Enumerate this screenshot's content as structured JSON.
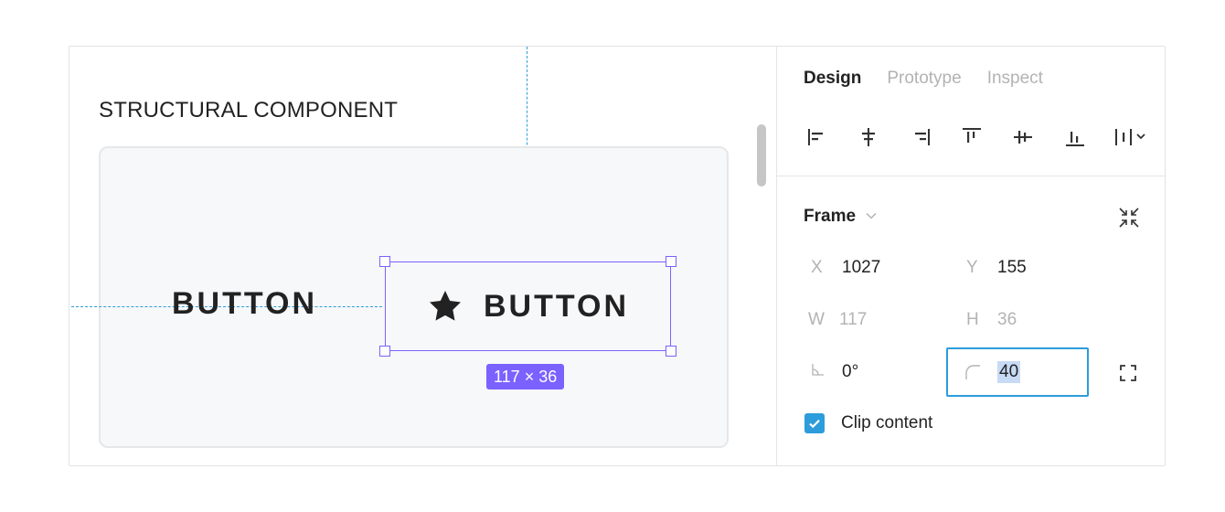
{
  "canvas": {
    "title": "STRUCTURAL COMPONENT",
    "text_button_label": "BUTTON",
    "icon_button_label": "BUTTON",
    "icon_button_icon": "star-icon",
    "size_badge": "117 × 36"
  },
  "panel": {
    "tabs": [
      {
        "label": "Design",
        "active": true
      },
      {
        "label": "Prototype",
        "active": false
      },
      {
        "label": "Inspect",
        "active": false
      }
    ],
    "align_tools": [
      "align-left-icon",
      "align-horizontal-center-icon",
      "align-right-icon",
      "align-top-icon",
      "align-vertical-center-icon",
      "align-bottom-icon",
      "distribute-icon"
    ],
    "frame": {
      "title": "Frame",
      "x_label": "X",
      "x": "1027",
      "y_label": "Y",
      "y": "155",
      "w_label": "W",
      "w": "117",
      "h_label": "H",
      "h": "36",
      "rotation": "0°",
      "corner_radius": "40",
      "clip_content_label": "Clip content",
      "clip_content_checked": true
    }
  },
  "colors": {
    "selection": "#7b61ff",
    "guide": "#2d9cdb",
    "focus": "#2d9cdb",
    "text_highlight": "#c8dbf5"
  }
}
